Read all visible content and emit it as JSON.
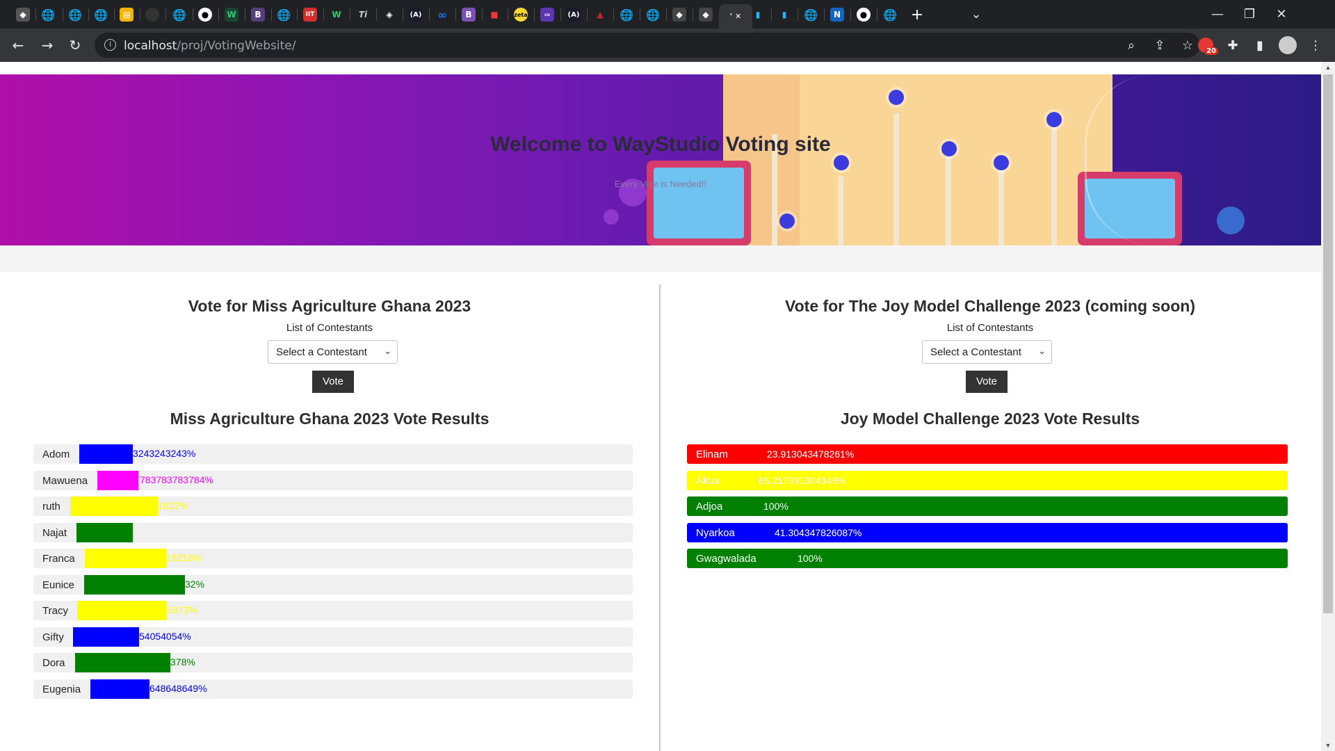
{
  "browser": {
    "url_host": "localhost",
    "url_path": "/proj/VotingWebsite/",
    "extension_badge": "20",
    "tabs": [
      "github",
      "wix",
      "bootstrap",
      "twitter",
      "meta",
      "nextjs",
      "notion",
      "github2"
    ]
  },
  "hero": {
    "title": "Welcome to WayStudio Voting site",
    "subtitle": "Every Vote is Needed!!"
  },
  "left": {
    "title": "Vote for Miss Agriculture Ghana 2023",
    "list_label": "List of Contestants",
    "select_value": "Select a Contestant",
    "vote_label": "Vote",
    "results_title": "Miss Agriculture Ghana 2023 Vote Results",
    "results": [
      {
        "name": "Adom",
        "pct_text": "3243243243%",
        "color": "#0000ff"
      },
      {
        "name": "Mawuena",
        "pct_text": "783783783784%",
        "color": "#ff00ff"
      },
      {
        "name": "ruth",
        "pct_text": "1622%",
        "color": "#ffff00"
      },
      {
        "name": "Najat",
        "pct_text": "",
        "color": "#008000"
      },
      {
        "name": "Franca",
        "pct_text": "16216%",
        "color": "#ffff00"
      },
      {
        "name": "Eunice",
        "pct_text": "32%",
        "color": "#008000"
      },
      {
        "name": "Tracy",
        "pct_text": "5973%",
        "color": "#ffff00"
      },
      {
        "name": "Gifty",
        "pct_text": "54054054%",
        "color": "#0000ff"
      },
      {
        "name": "Dora",
        "pct_text": "378%",
        "color": "#008000"
      },
      {
        "name": "Eugenia",
        "pct_text": "648648649%",
        "color": "#0000ff"
      }
    ]
  },
  "right": {
    "title": "Vote for The Joy Model Challenge 2023 (coming soon)",
    "list_label": "List of Contestants",
    "select_value": "Select a Contestant",
    "vote_label": "Vote",
    "results_title": "Joy Model Challenge 2023 Vote Results",
    "results": [
      {
        "name": "Elinam",
        "pct_text": "23.913043478261%",
        "color": "#ff0000"
      },
      {
        "name": "Akua",
        "pct_text": "65.217391304348%",
        "color": "#ffff00"
      },
      {
        "name": "Adjoa",
        "pct_text": "100%",
        "color": "#008000"
      },
      {
        "name": "Nyarkoa",
        "pct_text": "41.304347826087%",
        "color": "#0000ff"
      },
      {
        "name": "Gwagwalada",
        "pct_text": "100%",
        "color": "#008000"
      }
    ]
  }
}
